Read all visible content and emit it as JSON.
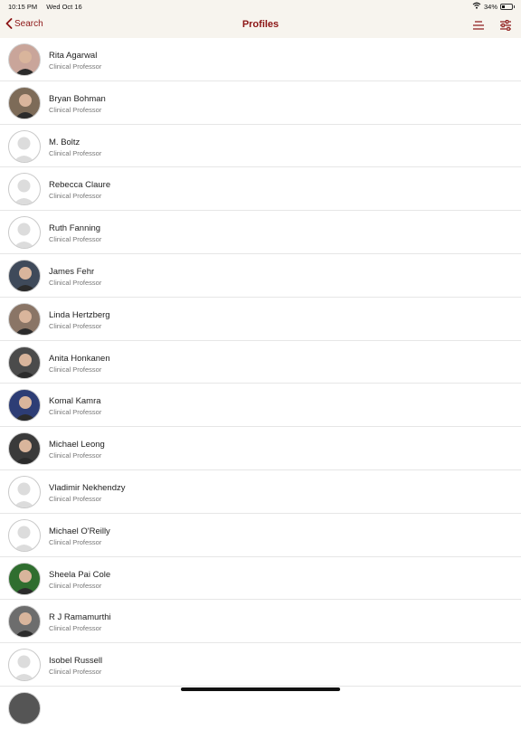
{
  "status": {
    "time": "10:15 PM",
    "date": "Wed Oct 16",
    "battery": "34%",
    "battery_level": 0.34,
    "icons": [
      "wifi-icon",
      "battery-icon"
    ]
  },
  "nav": {
    "back_label": "Search",
    "title": "Profiles",
    "accent": "#8c1515",
    "icons": [
      "list-icon",
      "filter-sliders-icon"
    ]
  },
  "profiles": [
    {
      "name": "Rita Agarwal",
      "title": "Clinical Professor",
      "has_photo": true,
      "avatar_bg": "#c9a59a"
    },
    {
      "name": "Bryan Bohman",
      "title": "Clinical Professor",
      "has_photo": true,
      "avatar_bg": "#7d6b58"
    },
    {
      "name": "M. Boltz",
      "title": "Clinical Professor",
      "has_photo": false
    },
    {
      "name": "Rebecca Claure",
      "title": "Clinical Professor",
      "has_photo": false
    },
    {
      "name": "Ruth Fanning",
      "title": "Clinical Professor",
      "has_photo": false
    },
    {
      "name": "James Fehr",
      "title": "Clinical Professor",
      "has_photo": true,
      "avatar_bg": "#3f4a5a"
    },
    {
      "name": "Linda Hertzberg",
      "title": "Clinical Professor",
      "has_photo": true,
      "avatar_bg": "#8a7566"
    },
    {
      "name": "Anita Honkanen",
      "title": "Clinical Professor",
      "has_photo": true,
      "avatar_bg": "#4b4b4b"
    },
    {
      "name": "Komal Kamra",
      "title": "Clinical Professor",
      "has_photo": true,
      "avatar_bg": "#2d3d75"
    },
    {
      "name": "Michael Leong",
      "title": "Clinical Professor",
      "has_photo": true,
      "avatar_bg": "#3a3a3a"
    },
    {
      "name": "Vladimir Nekhendzy",
      "title": "Clinical Professor",
      "has_photo": false
    },
    {
      "name": "Michael O'Reilly",
      "title": "Clinical Professor",
      "has_photo": false
    },
    {
      "name": "Sheela Pai Cole",
      "title": "Clinical Professor",
      "has_photo": true,
      "avatar_bg": "#2f6e2f"
    },
    {
      "name": "R J Ramamurthi",
      "title": "Clinical Professor",
      "has_photo": true,
      "avatar_bg": "#6d6d6d"
    },
    {
      "name": "Isobel Russell",
      "title": "Clinical Professor",
      "has_photo": false
    }
  ]
}
